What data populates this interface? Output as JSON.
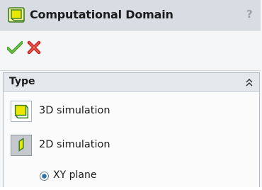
{
  "dialog": {
    "title": "Computational Domain",
    "help_label": "?"
  },
  "actions": {
    "ok_icon": "check-icon",
    "cancel_icon": "x-icon"
  },
  "type_group": {
    "title": "Type",
    "options": [
      {
        "label": "3D simulation",
        "icon": "cube-icon",
        "selected": false
      },
      {
        "label": "2D simulation",
        "icon": "plane-icon",
        "selected": true
      }
    ],
    "plane_option": {
      "label": "XY plane",
      "checked": true
    }
  },
  "colors": {
    "title_bar": "#d9dde3",
    "accent_yellow": "#e8e800",
    "ok_green": "#3c9a1f",
    "cancel_red": "#d0231f"
  }
}
